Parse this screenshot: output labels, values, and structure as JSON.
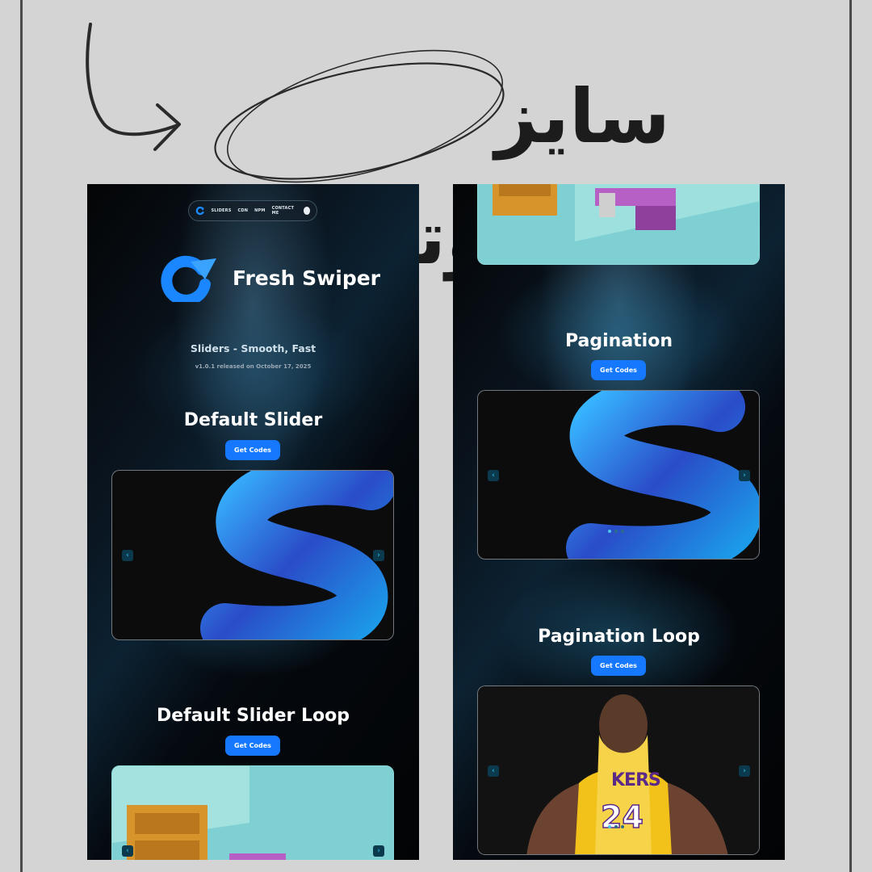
{
  "header": {
    "title": "سایز کامپیوتر"
  },
  "nav": {
    "items": [
      "SLIDERS",
      "CDN",
      "NPM",
      "CONTACT ME"
    ]
  },
  "brand": {
    "name": "Fresh Swiper",
    "tagline": "Sliders - Smooth, Fast",
    "version": "v1.0.1 released on October 17, 2025"
  },
  "sections": {
    "default": {
      "title": "Default Slider",
      "button": "Get Codes"
    },
    "default_loop": {
      "title": "Default Slider Loop",
      "button": "Get Codes"
    },
    "pagination": {
      "title": "Pagination",
      "button": "Get Codes"
    },
    "pagination_loop": {
      "title": "Pagination Loop",
      "button": "Get Codes"
    }
  },
  "slides": {
    "jersey_text": "KERS",
    "jersey_number": "24"
  },
  "icons": {
    "prev": "chevron-left-icon",
    "next": "chevron-right-icon",
    "github": "github-icon",
    "logo": "refresh-arrow-icon"
  },
  "colors": {
    "accent": "#1578ff",
    "background": "#d4d4d4",
    "arrow": "#2aa9d6",
    "ink": "#1c1c1c"
  }
}
